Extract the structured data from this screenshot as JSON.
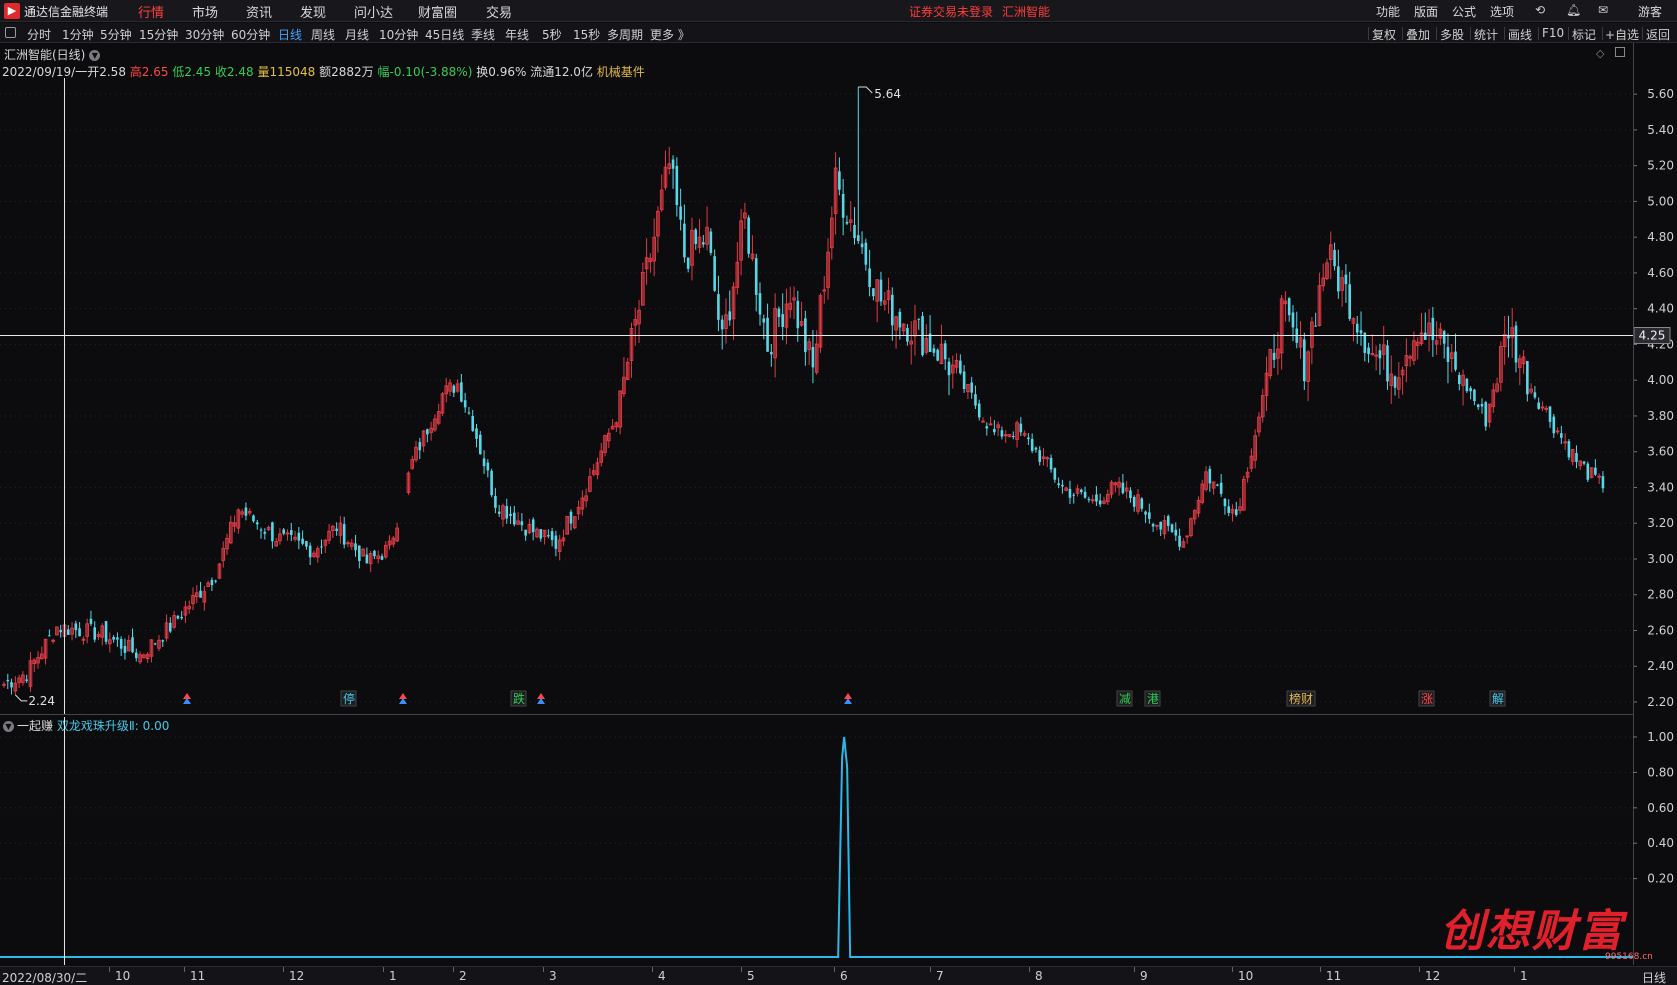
{
  "app": {
    "title": "通达信金融终端",
    "logo_glyph": "▶"
  },
  "menu": [
    {
      "label": "行情",
      "active": true
    },
    {
      "label": "市场"
    },
    {
      "label": "资讯"
    },
    {
      "label": "发现"
    },
    {
      "label": "问小达"
    },
    {
      "label": "财富圈"
    },
    {
      "label": "交易"
    }
  ],
  "header_status": {
    "login": "证券交易未登录",
    "stock": "汇洲智能"
  },
  "right_menu": [
    "功能",
    "版面",
    "公式",
    "选项"
  ],
  "user_label": "游客",
  "periods": [
    "分时",
    "1分钟",
    "5分钟",
    "15分钟",
    "30分钟",
    "60分钟",
    "日线",
    "周线",
    "月线",
    "10分钟",
    "45日线",
    "季线",
    "年线",
    "5秒",
    "15秒",
    "多周期",
    "更多 》"
  ],
  "active_period": "日线",
  "tools": [
    "复权",
    "叠加",
    "多股",
    "统计",
    "画线",
    "F10",
    "标记",
    "+自选",
    "返回"
  ],
  "stock": {
    "title": "汇洲智能(日线)"
  },
  "info": {
    "date": "2022/09/19/一",
    "open_label": "开",
    "open": "2.58",
    "high_label": "高",
    "high": "2.65",
    "low_label": "低",
    "low": "2.45",
    "close_label": "收",
    "close": "2.48",
    "vol_label": "量",
    "vol": "115048",
    "amt_label": "额",
    "amt": "2882万",
    "chg_label": "幅",
    "chg": "-0.10(-3.88%)",
    "turn_label": "换",
    "turn": "0.96%",
    "float_label": "流通",
    "float": "12.0亿",
    "sector": "机械基件"
  },
  "main_axis": {
    "ticks": [
      "5.60",
      "5.40",
      "5.20",
      "5.00",
      "4.80",
      "4.60",
      "4.40",
      "4.20",
      "4.00",
      "3.80",
      "3.60",
      "3.40",
      "3.20",
      "3.00",
      "2.80",
      "2.60",
      "2.40",
      "2.20"
    ],
    "crosshair_value": "4.25",
    "max_label": "5.64",
    "min_label": "2.24"
  },
  "signals": [
    {
      "text": "停",
      "color": "#45c8e6"
    },
    {
      "text": "跌",
      "color": "#33cc55"
    },
    {
      "text": "减",
      "color": "#33cc55"
    },
    {
      "text": "港",
      "color": "#33cc55"
    },
    {
      "text": "榜财",
      "color": "#e2b84a"
    },
    {
      "text": "涨",
      "color": "#ff4545"
    },
    {
      "text": "解",
      "color": "#45c8e6"
    }
  ],
  "indicator": {
    "panel_name": "一起赚",
    "name": "双龙戏珠升级Ⅱ",
    "value": "0.00",
    "ticks": [
      "1.00",
      "0.80",
      "0.60",
      "0.40",
      "0.20"
    ]
  },
  "timebar": {
    "start_date": "2022/08/30/二",
    "months": [
      "10",
      "11",
      "12",
      "1",
      "2",
      "3",
      "4",
      "5",
      "6",
      "7",
      "8",
      "9",
      "10",
      "11",
      "12",
      "1"
    ],
    "period": "日线"
  },
  "watermark": {
    "text": "创想财富",
    "url": "995168.cn"
  },
  "colors": {
    "up": "#e03a45",
    "down": "#56d8e8",
    "background": "#0c0c0e",
    "indicator": "#2ab8e8"
  },
  "chart_data": {
    "type": "candlestick",
    "y_range": [
      2.2,
      5.64
    ],
    "anchor_closes": [
      [
        0,
        2.3
      ],
      [
        6,
        2.36
      ],
      [
        14,
        2.62
      ],
      [
        26,
        2.58
      ],
      [
        36,
        2.46
      ],
      [
        44,
        2.62
      ],
      [
        56,
        2.92
      ],
      [
        62,
        3.28
      ],
      [
        72,
        3.12
      ],
      [
        82,
        3.05
      ],
      [
        88,
        3.18
      ],
      [
        96,
        2.98
      ],
      [
        102,
        3.06
      ],
      [
        108,
        3.54
      ],
      [
        116,
        3.92
      ],
      [
        120,
        3.98
      ],
      [
        124,
        3.76
      ],
      [
        130,
        3.32
      ],
      [
        138,
        3.18
      ],
      [
        146,
        3.08
      ],
      [
        154,
        3.4
      ],
      [
        162,
        3.8
      ],
      [
        170,
        4.6
      ],
      [
        176,
        5.2
      ],
      [
        180,
        4.7
      ],
      [
        186,
        4.8
      ],
      [
        190,
        4.2
      ],
      [
        196,
        4.9
      ],
      [
        202,
        4.2
      ],
      [
        208,
        4.5
      ],
      [
        214,
        4.05
      ],
      [
        220,
        5.1
      ],
      [
        226,
        4.8
      ],
      [
        232,
        4.45
      ],
      [
        240,
        4.3
      ],
      [
        248,
        4.15
      ],
      [
        256,
        3.9
      ],
      [
        262,
        3.7
      ],
      [
        268,
        3.72
      ],
      [
        274,
        3.58
      ],
      [
        280,
        3.4
      ],
      [
        288,
        3.32
      ],
      [
        294,
        3.4
      ],
      [
        300,
        3.32
      ],
      [
        306,
        3.18
      ],
      [
        312,
        3.1
      ],
      [
        318,
        3.48
      ],
      [
        326,
        3.25
      ],
      [
        332,
        3.8
      ],
      [
        338,
        4.38
      ],
      [
        344,
        4.1
      ],
      [
        350,
        4.7
      ],
      [
        356,
        4.45
      ],
      [
        362,
        4.15
      ],
      [
        368,
        4.05
      ],
      [
        374,
        4.3
      ],
      [
        380,
        4.2
      ],
      [
        386,
        4.0
      ],
      [
        392,
        3.78
      ],
      [
        398,
        4.3
      ],
      [
        404,
        3.96
      ],
      [
        410,
        3.75
      ],
      [
        416,
        3.55
      ],
      [
        422,
        3.42
      ]
    ],
    "max": {
      "index": 226,
      "value": 5.64
    },
    "min": {
      "index": 3,
      "value": 2.24
    },
    "crosshair": {
      "index": 16,
      "price": 4.25
    },
    "indicator": {
      "name": "双龙戏珠升级Ⅱ",
      "range": [
        0,
        1
      ],
      "spike_index": 213,
      "spike_value": 1.0,
      "baseline": 0
    }
  }
}
